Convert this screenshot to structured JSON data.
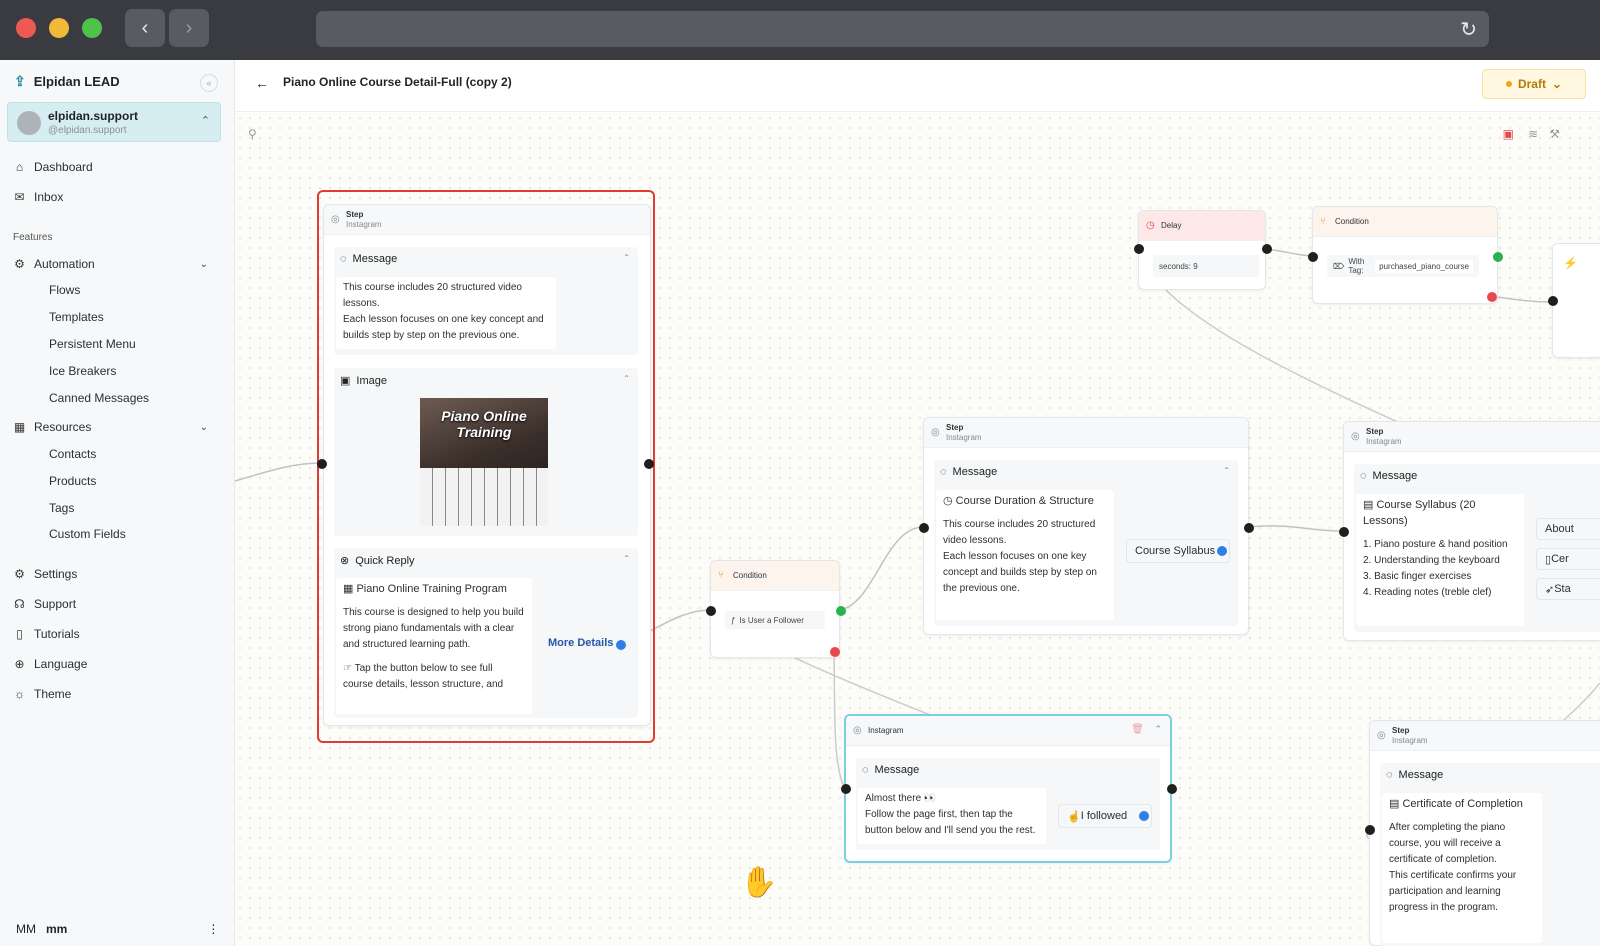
{
  "app": {
    "name": "Elpidan LEAD"
  },
  "account": {
    "name": "elpidan.support",
    "handle": "@elpidan.support"
  },
  "nav": {
    "dashboard": "Dashboard",
    "inbox": "Inbox",
    "features": "Features",
    "automation": "Automation",
    "automation_items": [
      "Flows",
      "Templates",
      "Persistent Menu",
      "Ice Breakers",
      "Canned Messages"
    ],
    "resources": "Resources",
    "resources_items": [
      "Contacts",
      "Products",
      "Tags",
      "Custom Fields"
    ],
    "settings": "Settings",
    "support": "Support",
    "tutorials": "Tutorials",
    "language": "Language",
    "theme": "Theme"
  },
  "user": {
    "initials": "MM",
    "name": "mm"
  },
  "header": {
    "title": "Piano Online Course Detail-Full (copy 2)",
    "status": "Draft"
  },
  "node1": {
    "kind": "Step",
    "channel": "Instagram",
    "message_label": "Message",
    "message_text": "This course includes 20 structured video lessons.\nEach lesson focuses on one key concept and builds step by step on the previous one.",
    "image_label": "Image",
    "image_title": "Piano Online Training",
    "quick_reply_label": "Quick Reply",
    "qr_title": "Piano Online Training Program",
    "qr_text": "This course is designed to help you build strong piano fundamentals with a clear and structured learning path.",
    "qr_text2": "Tap the button below to see full course details, lesson structure, and",
    "button": "More Details"
  },
  "condition1": {
    "label": "Condition",
    "rule": "Is User a Follower"
  },
  "node2": {
    "kind": "Step",
    "channel": "Instagram",
    "message_label": "Message",
    "title": "Course Duration & Structure",
    "text": "This course includes 20 structured video lessons.\nEach lesson focuses on one key concept and builds step by step on the previous one.",
    "button": "Course Syllabus"
  },
  "delay": {
    "label": "Delay",
    "value": "seconds: 9"
  },
  "condition2": {
    "label": "Condition",
    "tag_label": "With Tag:",
    "tag": "purchased_piano_course"
  },
  "node3": {
    "kind": "Step",
    "channel": "Instagram",
    "message_label": "Message",
    "title": "Course Syllabus (20 Lessons)",
    "items": [
      "1. Piano posture & hand position",
      "2. Understanding the keyboard",
      "3. Basic finger exercises",
      "4. Reading notes (treble clef)"
    ],
    "buttons": [
      "About",
      "Cer",
      "Sta"
    ]
  },
  "node4": {
    "channel": "Instagram",
    "message_label": "Message",
    "text": "Almost there 👀\nFollow the page first, then tap the button below and I'll send you the rest.",
    "button": "I followed"
  },
  "node5": {
    "kind": "Step",
    "channel": "Instagram",
    "message_label": "Message",
    "title": "Certificate of Completion",
    "text": "After completing the piano course, you will receive a certificate of completion.\nThis certificate confirms your participation and learning progress in the program."
  }
}
